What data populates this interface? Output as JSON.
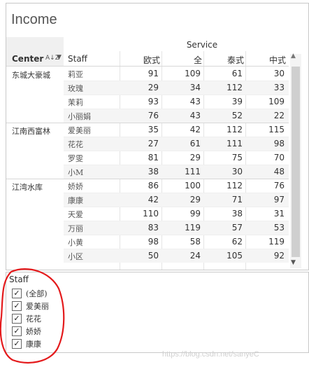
{
  "sheet": {
    "title": "Income",
    "column_group_header": "Service",
    "row_headers": {
      "center": "Center",
      "staff": "Staff"
    },
    "columns": [
      "欧式",
      "全",
      "泰式",
      "中式"
    ],
    "groups": [
      {
        "center": "东城大豪城",
        "rows": [
          {
            "staff": "莉亚",
            "values": [
              91,
              109,
              61,
              30
            ]
          },
          {
            "staff": "玫瑰",
            "values": [
              29,
              34,
              112,
              33
            ]
          },
          {
            "staff": "茉莉",
            "values": [
              93,
              43,
              39,
              109
            ]
          },
          {
            "staff": "小丽娟",
            "values": [
              76,
              43,
              52,
              22
            ]
          }
        ]
      },
      {
        "center": "江南西富林",
        "rows": [
          {
            "staff": "爱美丽",
            "values": [
              35,
              42,
              112,
              115
            ]
          },
          {
            "staff": "花花",
            "values": [
              27,
              61,
              111,
              98
            ]
          },
          {
            "staff": "罗雯",
            "values": [
              81,
              29,
              75,
              70
            ]
          },
          {
            "staff": "小M",
            "values": [
              38,
              111,
              30,
              48
            ]
          }
        ]
      },
      {
        "center": "江湾水库",
        "rows": [
          {
            "staff": "娇娇",
            "values": [
              86,
              100,
              112,
              76
            ]
          },
          {
            "staff": "康康",
            "values": [
              42,
              29,
              71,
              97
            ]
          },
          {
            "staff": "天爱",
            "values": [
              110,
              99,
              38,
              31
            ]
          },
          {
            "staff": "万丽",
            "values": [
              83,
              119,
              57,
              53
            ]
          },
          {
            "staff": "小黄",
            "values": [
              98,
              58,
              62,
              119
            ]
          },
          {
            "staff": "小区",
            "values": [
              50,
              24,
              105,
              92
            ]
          }
        ]
      }
    ]
  },
  "filter": {
    "title": "Staff",
    "items": [
      {
        "label": "(全部)",
        "checked": true
      },
      {
        "label": "爱美丽",
        "checked": true
      },
      {
        "label": "花花",
        "checked": true
      },
      {
        "label": "娇娇",
        "checked": true
      },
      {
        "label": "康康",
        "checked": true
      }
    ]
  },
  "watermark": "https://blog.csdn.net/sanyeC",
  "colors": {
    "annotation": "#e41a1c"
  }
}
